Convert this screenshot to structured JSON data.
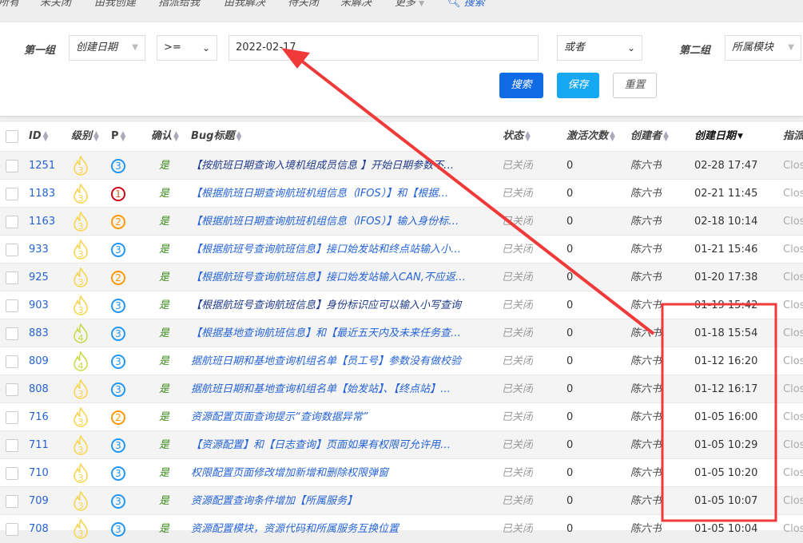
{
  "tabs": [
    "所有",
    "未关闭",
    "由我创建",
    "指派给我",
    "由我解决",
    "待关闭",
    "未解决",
    "更多",
    "搜索"
  ],
  "search": {
    "group1_label": "第一组",
    "group1_field": "创建日期",
    "group1_op": ">=",
    "group1_value": "2022-02-17",
    "logic": "或者",
    "group2_label": "第二组",
    "group2_field": "所属模块",
    "search_btn": "搜索",
    "save_btn": "保存",
    "reset_btn": "重置"
  },
  "headers": {
    "id": "ID",
    "severity": "级别",
    "pri": "P",
    "confirmed": "确认",
    "title": "Bug标题",
    "status": "状态",
    "activations": "激活次数",
    "creator": "创建者",
    "created": "创建日期",
    "assigned": "指派"
  },
  "rows": [
    {
      "id": "1251",
      "sev": "3",
      "pri": "3",
      "confirmed": "是",
      "title": "【按航班日期查询入境机组成员信息 】开始日期参数不…",
      "status": "已关闭",
      "act": "0",
      "creator": "陈六书",
      "date": "02-28 17:47",
      "assigned": "Closed"
    },
    {
      "id": "1183",
      "sev": "3",
      "pri": "1",
      "confirmed": "是",
      "title": "【根据航班日期查询航班机组信息（IFOS）】和【根据…",
      "status": "已关闭",
      "act": "0",
      "creator": "陈六书",
      "date": "02-21 11:45",
      "assigned": "Closed"
    },
    {
      "id": "1163",
      "sev": "3",
      "pri": "2",
      "confirmed": "是",
      "title": "【根据航班日期查询航班机组信息（IFOS）】输入身份标…",
      "status": "已关闭",
      "act": "0",
      "creator": "陈六书",
      "date": "02-18 10:14",
      "assigned": "Closed"
    },
    {
      "id": "933",
      "sev": "3",
      "pri": "3",
      "confirmed": "是",
      "title": "【根据航班号查询航班信息】接口始发站和终点站输入小…",
      "status": "已关闭",
      "act": "0",
      "creator": "陈六书",
      "date": "01-21 15:46",
      "assigned": "Closed"
    },
    {
      "id": "925",
      "sev": "3",
      "pri": "2",
      "confirmed": "是",
      "title": "【根据航班号查询航班信息】接口始发站输入CAN,不应返…",
      "status": "已关闭",
      "act": "0",
      "creator": "陈六书",
      "date": "01-20 17:38",
      "assigned": "Closed"
    },
    {
      "id": "903",
      "sev": "3",
      "pri": "3",
      "confirmed": "是",
      "title": "【根据航班号查询航班信息】身份标识应可以输入小写查询",
      "status": "已关闭",
      "act": "0",
      "creator": "陈六书",
      "date": "01-19 15:42",
      "assigned": "Closed"
    },
    {
      "id": "883",
      "sev": "4",
      "pri": "3",
      "confirmed": "是",
      "title": "【根据基地查询航班信息】和【最近五天内及未来任务查…",
      "status": "已关闭",
      "act": "0",
      "creator": "陈六书",
      "date": "01-18 15:54",
      "assigned": "Closed"
    },
    {
      "id": "809",
      "sev": "4",
      "pri": "3",
      "confirmed": "是",
      "title": "据航班日期和基地查询机组名单【员工号】参数没有做校验",
      "status": "已关闭",
      "act": "0",
      "creator": "陈六书",
      "date": "01-12 16:20",
      "assigned": "Closed"
    },
    {
      "id": "808",
      "sev": "3",
      "pri": "3",
      "confirmed": "是",
      "title": "据航班日期和基地查询机组名单【始发站】、【终点站】…",
      "status": "已关闭",
      "act": "0",
      "creator": "陈六书",
      "date": "01-12 16:17",
      "assigned": "Closed"
    },
    {
      "id": "716",
      "sev": "3",
      "pri": "2",
      "confirmed": "是",
      "title": "资源配置页面查询提示“查询数据异常”",
      "status": "已关闭",
      "act": "0",
      "creator": "陈六书",
      "date": "01-05 16:00",
      "assigned": "Closed"
    },
    {
      "id": "711",
      "sev": "3",
      "pri": "3",
      "confirmed": "是",
      "title": "【资源配置】和【日志查询】页面如果有权限可允许用…",
      "status": "已关闭",
      "act": "0",
      "creator": "陈六书",
      "date": "01-05 10:29",
      "assigned": "Closed"
    },
    {
      "id": "710",
      "sev": "3",
      "pri": "3",
      "confirmed": "是",
      "title": "权限配置页面修改增加新增和删除权限弹窗",
      "status": "已关闭",
      "act": "0",
      "creator": "陈六书",
      "date": "01-05 10:20",
      "assigned": "Closed"
    },
    {
      "id": "709",
      "sev": "3",
      "pri": "3",
      "confirmed": "是",
      "title": "资源配置查询条件增加【所属服务】",
      "status": "已关闭",
      "act": "0",
      "creator": "陈六书",
      "date": "01-05 10:07",
      "assigned": "Closed"
    },
    {
      "id": "708",
      "sev": "3",
      "pri": "3",
      "confirmed": "是",
      "title": "资源配置模块，资源代码和所属服务互换位置",
      "status": "已关闭",
      "act": "0",
      "creator": "陈六书",
      "date": "01-05 10:04",
      "assigned": "Closed"
    }
  ],
  "colors": {
    "primary": "#0f6ae6",
    "save": "#16a9f2",
    "annotation": "#f03a3a",
    "sev3": "#f8d347",
    "sev4": "#c8d840",
    "p1": "#d0021b",
    "p2": "#ff9800",
    "p3": "#2196f3"
  }
}
